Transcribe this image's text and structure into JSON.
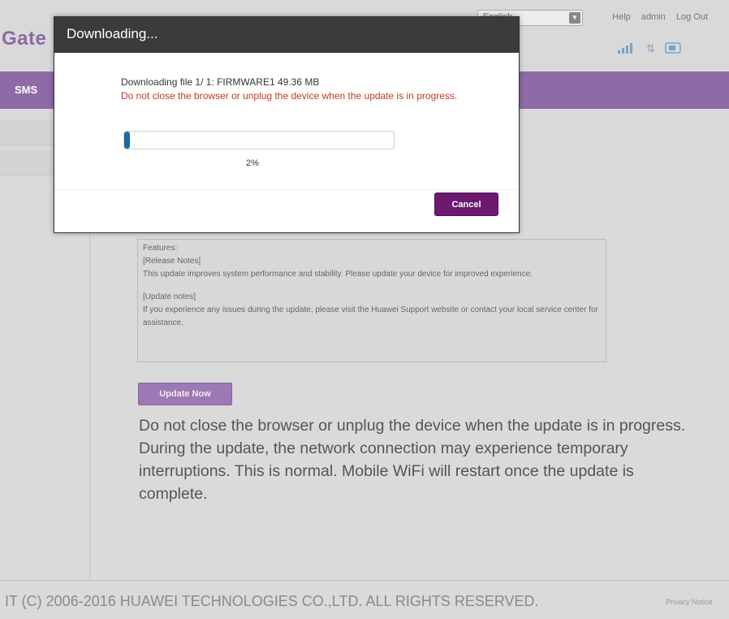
{
  "header": {
    "logo_text": "Gate",
    "language_value": "English",
    "help_label": "Help",
    "user_label": "admin",
    "logout_label": "Log Out",
    "signal_icon": "signal-icon",
    "data_icon": "updown-arrows-icon",
    "sim_icon": "sim-icon"
  },
  "nav": {
    "item_label": "SMS"
  },
  "features": {
    "title": "Features:",
    "release_heading": "[Release Notes]",
    "release_text": "This update improves system performance and stability. Please update your device for improved experience.",
    "update_heading": "[Update notes]",
    "update_text": "If you experience any issues during the update, please visit the Huawei Support website or contact your local service center for assistance."
  },
  "update_button_label": "Update Now",
  "warning": {
    "line1": "Do not close the browser or unplug the device when the update is in progress.",
    "line2": "During the update, the network connection may experience temporary interruptions. This is normal. Mobile WiFi will restart once the update is complete."
  },
  "footer": {
    "copyright": "IT (C) 2006-2016 HUAWEI TECHNOLOGIES CO.,LTD. ALL RIGHTS RESERVED.",
    "privacy": "Privacy Notice"
  },
  "modal": {
    "title": "Downloading...",
    "file_text": "Downloading file 1/ 1: FIRMWARE1 49.36 MB",
    "warning_text": "Do not close the browser or unplug the device when the update is in progress.",
    "progress_percent": 2,
    "progress_label": "2%",
    "cancel_label": "Cancel"
  },
  "colors": {
    "brand_purple": "#8e6aa6",
    "cancel_purple": "#6b1a6f",
    "progress_blue": "#1a6aa3",
    "warning_red": "#c0392b"
  }
}
